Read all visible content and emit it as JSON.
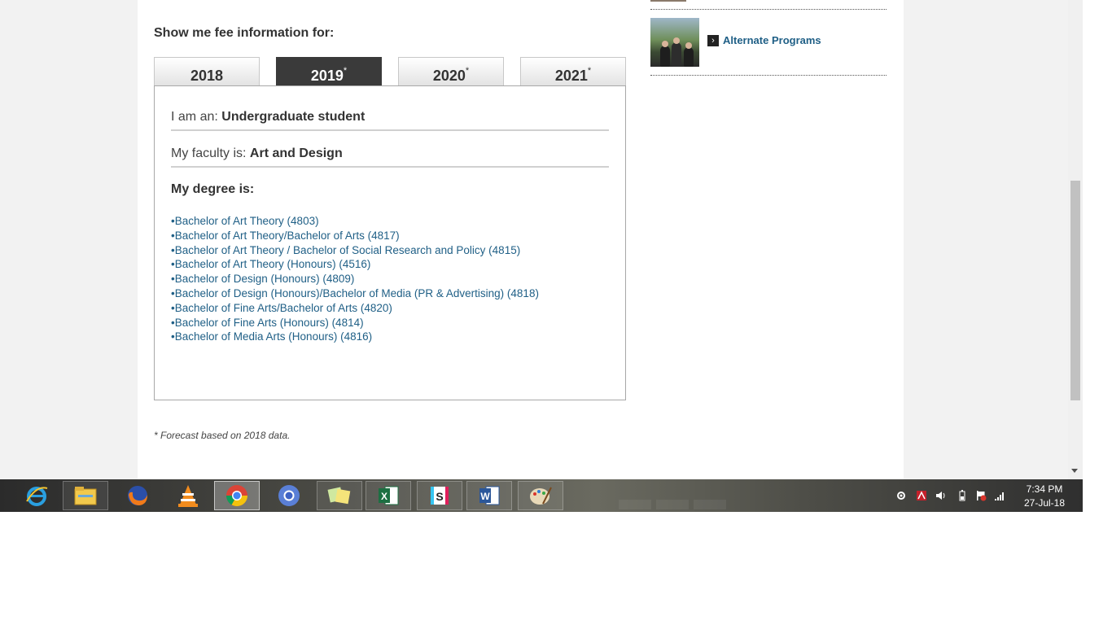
{
  "fee": {
    "heading": "Show me fee information for:",
    "tabs": [
      {
        "label": "2018",
        "asterisk": ""
      },
      {
        "label": "2019",
        "asterisk": "*"
      },
      {
        "label": "2020",
        "asterisk": "*"
      },
      {
        "label": "2021",
        "asterisk": "*"
      }
    ],
    "selected_tab": "2019",
    "iam_label": "I am an:",
    "iam_value": "Undergraduate student",
    "faculty_label": "My faculty is:",
    "faculty_value": "Art and Design",
    "degree_label": "My degree is:",
    "degrees": [
      "Bachelor of Art Theory (4803)",
      "Bachelor of Art Theory/Bachelor of Arts (4817)",
      "Bachelor of Art Theory / Bachelor of Social Research and Policy (4815)",
      "Bachelor of Art Theory (Honours) (4516)",
      "Bachelor of Design (Honours) (4809)",
      "Bachelor of Design (Honours)/Bachelor of Media (PR & Advertising) (4818)",
      "Bachelor of Fine Arts/Bachelor of Arts (4820)",
      "Bachelor of Fine Arts (Honours) (4814)",
      "Bachelor of Media Arts (Honours) (4816)"
    ],
    "forecast_note": "* Forecast based on 2018 data."
  },
  "sidebar": {
    "alternate_programs_label": "Alternate Programs"
  },
  "colors": {
    "link": "#1f5f86",
    "active_tab": "#3a3a3a",
    "text": "#333333"
  },
  "taskbar": {
    "apps": [
      {
        "name": "internet-explorer-icon"
      },
      {
        "name": "file-explorer-icon"
      },
      {
        "name": "firefox-icon"
      },
      {
        "name": "vlc-icon"
      },
      {
        "name": "chrome-icon"
      },
      {
        "name": "chromium-icon"
      },
      {
        "name": "sticky-notes-icon"
      },
      {
        "name": "excel-icon"
      },
      {
        "name": "slack-icon"
      },
      {
        "name": "word-icon"
      },
      {
        "name": "paint-icon"
      }
    ],
    "clock_time": "7:34 PM",
    "clock_date": "27-Jul-18"
  }
}
